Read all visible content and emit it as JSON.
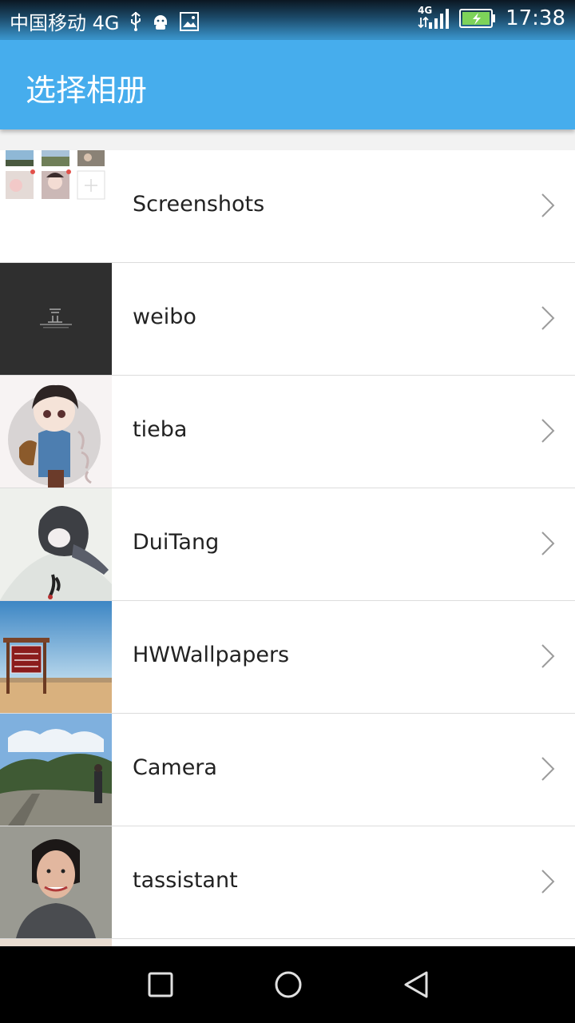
{
  "status_bar": {
    "carrier": "中国移动 4G",
    "network_label": "4G",
    "time": "17:38",
    "icons": [
      "usb-icon",
      "android-icon",
      "image-icon",
      "signal-icon",
      "battery-charging-icon"
    ]
  },
  "app_bar": {
    "title": "选择相册"
  },
  "albums": [
    {
      "label": "Screenshots",
      "thumb": "screenshots-collage"
    },
    {
      "label": "weibo",
      "thumb": "dark-logo"
    },
    {
      "label": "tieba",
      "thumb": "cartoon-girl"
    },
    {
      "label": "DuiTang",
      "thumb": "ink-illustration"
    },
    {
      "label": "HWWallpapers",
      "thumb": "colorado-sign"
    },
    {
      "label": "Camera",
      "thumb": "mountain-road"
    },
    {
      "label": "tassistant",
      "thumb": "portrait"
    }
  ],
  "nav_bar": {
    "icons": [
      "recent-apps-icon",
      "home-icon",
      "back-icon"
    ]
  },
  "colors": {
    "app_bar": "#46aded",
    "nav_bar": "#000000",
    "divider": "#dcdcdc"
  }
}
